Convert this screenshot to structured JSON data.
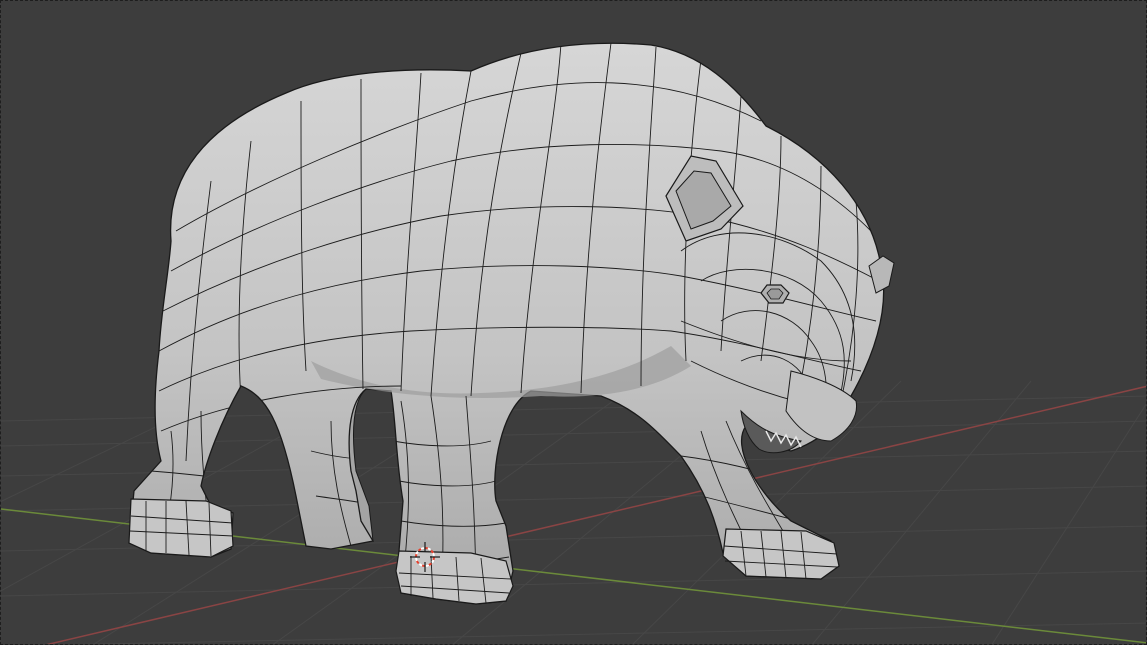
{
  "app": {
    "view": "3D Viewport",
    "shading": "solid",
    "overlay": "wireframe"
  },
  "scene": {
    "object_icon": "bear-mesh-icon",
    "cursor_icon": "3d-cursor-icon"
  },
  "colors": {
    "background": "#3d3d3d",
    "grid": "#4a4a4a",
    "x_axis": "#8a4444",
    "y_axis": "#6b8a3a",
    "mesh_fill": "#c8c8c8",
    "mesh_shadow": "#9c9c9c",
    "wire": "#1a1a1a",
    "cursor_red": "#e8402c"
  }
}
